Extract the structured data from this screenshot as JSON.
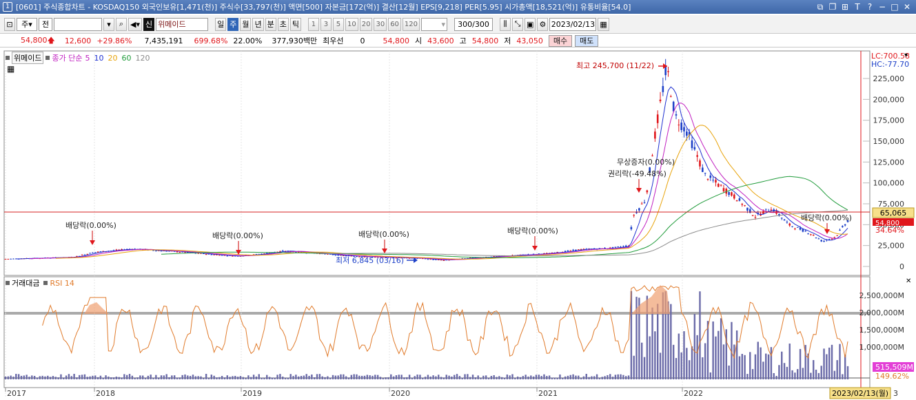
{
  "window": {
    "number": "1",
    "title": "[0601] 주식종합차트 - KOSDAQ150 외국인보유[1,471(천)] 주식수[33,797(천)] 액면[500] 자본금[172(억)] 결산[12월] EPS[9,218] PER[5.95] 시가총액[18,521(억)] 유통비율[54.0]"
  },
  "toolbar": {
    "market": "주",
    "mode": "전",
    "badge": "신",
    "stock_name": "위메이드",
    "periods": [
      "일",
      "주",
      "월",
      "년",
      "분",
      "초",
      "틱"
    ],
    "selected_period": "주",
    "intervals": [
      "1",
      "3",
      "5",
      "10",
      "20",
      "30",
      "60",
      "120"
    ],
    "count": "300/300",
    "date": "2023/02/13"
  },
  "quote": {
    "price": "54,800",
    "change": "12,600",
    "change_pct": "+29.86%",
    "volume": "7,435,191",
    "vol_ratio": "699.68%",
    "turnover": "22.00%",
    "amount": "377,930백만",
    "prefer": "최우선",
    "prefer_val": "0",
    "last": "54,800",
    "open_label": "시",
    "open": "43,600",
    "high_label": "고",
    "high": "54,800",
    "low_label": "저",
    "low": "43,050",
    "buy_label": "매수",
    "sell_label": "매도"
  },
  "price_panel": {
    "legend_name": "위메이드",
    "legend_ma": "종가 단순",
    "ma_periods": [
      "5",
      "10",
      "20",
      "60",
      "120"
    ],
    "lc": "LC:700.58",
    "hc": "HC:-77.70",
    "y_ticks": [
      "225,000",
      "200,000",
      "175,000",
      "150,000",
      "125,000",
      "100,000",
      "75,000",
      "50,000",
      "25,000",
      "0"
    ],
    "ref_line_value": "65,065",
    "last_price_tag": "54,800",
    "pct_tag": "34.64%",
    "annotations": {
      "max": "최고 245,700 (11/22)",
      "min": "최저 6,845 (03/16)",
      "div1": "배당락(0.00%)",
      "div2": "배당락(0.00%)",
      "div3": "배당락(0.00%)",
      "div4": "배당락(0.00%)",
      "div5": "배당락(0.00%)",
      "bonus": "무상증자(0.00%)",
      "rights": "권리락(-49.48%)"
    }
  },
  "volume_panel": {
    "legend_a": "거래대금",
    "legend_b": "RSI 14",
    "y_ticks": [
      "2,500,000M",
      "2,000,000M",
      "1,500,000M",
      "1,000,000M"
    ],
    "vol_tag": "515,509M",
    "rsi_tag": "149.62%"
  },
  "x_axis": {
    "labels": [
      "2017",
      "2018",
      "2019",
      "2020",
      "2021",
      "2022"
    ],
    "current": "2023/02/13(월)",
    "trail": "3"
  },
  "colors": {
    "up": "#e0161b",
    "down": "#1d40c8",
    "ma5": "#1d2fd0",
    "ma10": "#c01ec0",
    "ma20": "#e8a30a",
    "ma60": "#1f9b3a",
    "ma120": "#8a8a8a",
    "rsi": "#e07a2a",
    "volume": "#6a6aa8"
  }
}
